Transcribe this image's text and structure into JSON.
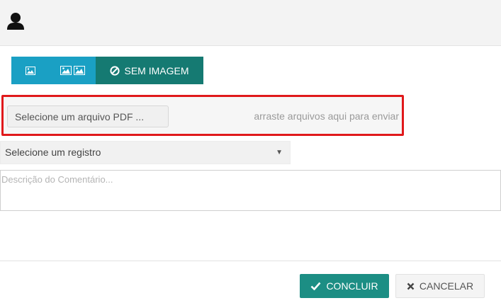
{
  "image_toolbar": {
    "single_image_icon": "image-icon",
    "double_image_icon": "images-icon",
    "no_image_icon": "ban-icon",
    "no_image_label": "SEM IMAGEM"
  },
  "upload": {
    "select_label": "Selecione um arquivo PDF ...",
    "drop_hint": "arraste arquivos aqui para enviar"
  },
  "record_select": {
    "selected": "Selecione um registro"
  },
  "comment": {
    "placeholder": "Descrição do Comentário..."
  },
  "actions": {
    "conclude_label": "CONCLUIR",
    "cancel_label": "CANCELAR"
  },
  "colors": {
    "header_bg": "#f3f3f3",
    "toolbar_blue": "#1aa0c4",
    "toolbar_teal": "#157a72",
    "highlight_red": "#e0191b",
    "conclude_green": "#1c8e84"
  }
}
